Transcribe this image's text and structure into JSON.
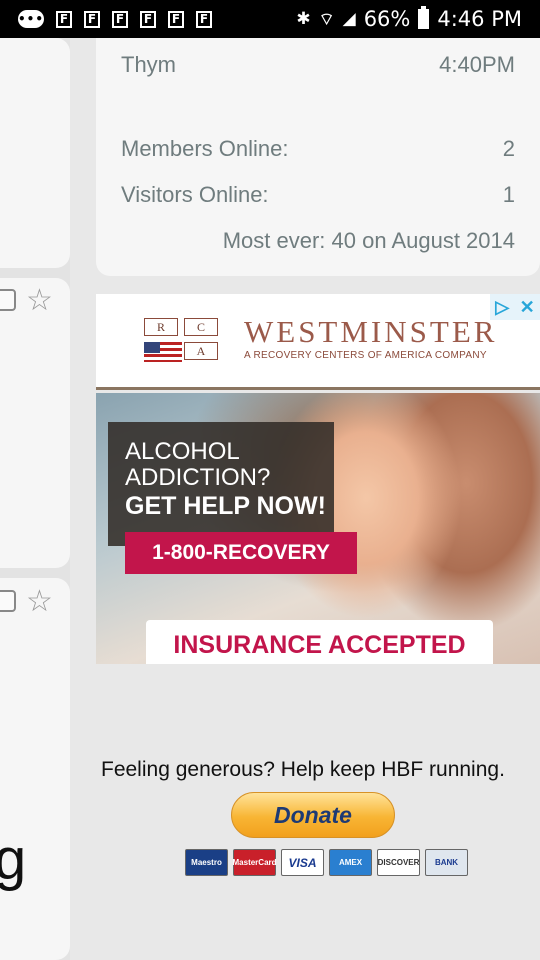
{
  "status_bar": {
    "icons": [
      "messages-icon",
      "flipboard-icon",
      "flipboard-icon",
      "flipboard-icon",
      "flipboard-icon",
      "flipboard-icon",
      "flipboard-icon",
      "bluetooth-icon",
      "wifi-icon",
      "signal-icon"
    ],
    "icon_glyphs": {
      "msg": "•••",
      "fb": "F",
      "bt": "✱",
      "wifi": "⌔",
      "signal": "◢"
    },
    "battery": "66%",
    "time": "4:46 PM"
  },
  "left_column": {
    "partial_text": "g"
  },
  "stats": {
    "last_user": {
      "name": "Thym",
      "time": "4:40PM"
    },
    "members_label": "Members Online:",
    "members_value": "2",
    "visitors_label": "Visitors Online:",
    "visitors_value": "1",
    "most_ever": "Most ever: 40 on August 2014"
  },
  "ad": {
    "logo_letters": [
      "R",
      "C",
      "A"
    ],
    "brand": "WESTMINSTER",
    "tagline": "A RECOVERY CENTERS OF AMERICA COMPANY",
    "adchoices_glyph": "▷",
    "close_glyph": "✕",
    "line1": "ALCOHOL",
    "line2": "ADDICTION?",
    "line3": "GET HELP NOW!",
    "phone": "1-800-RECOVERY",
    "insurance": "INSURANCE ACCEPTED"
  },
  "donate": {
    "message": "Feeling generous? Help keep HBF running.",
    "button": "Donate",
    "cards": [
      "Maestro",
      "MasterCard",
      "VISA",
      "AMEX",
      "DISCOVER",
      "BANK"
    ]
  },
  "colors": {
    "accent_red": "#c2154b",
    "stats_text": "#6f7c7e",
    "paypal_blue": "#1e3a74"
  }
}
